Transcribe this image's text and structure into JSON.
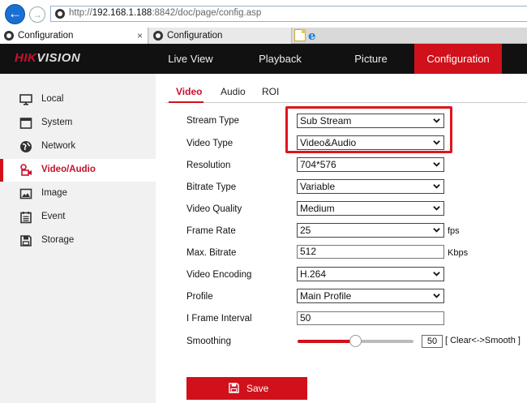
{
  "browser": {
    "url_prefix": "http://",
    "url_host": "192.168.1.188",
    "url_rest": ":8842/doc/page/config.asp",
    "tabs": [
      {
        "label": "Configuration",
        "active": true
      },
      {
        "label": "Configuration",
        "active": false
      }
    ],
    "close_glyph": "×"
  },
  "header": {
    "logo_red": "HIK",
    "logo_rest": "VISION",
    "nav": [
      "Live View",
      "Playback",
      "Picture",
      "Configuration"
    ],
    "active_nav": "Configuration"
  },
  "sidebar": {
    "items": [
      {
        "label": "Local",
        "icon": "monitor-icon"
      },
      {
        "label": "System",
        "icon": "window-icon"
      },
      {
        "label": "Network",
        "icon": "globe-icon"
      },
      {
        "label": "Video/Audio",
        "icon": "video-audio-icon",
        "active": true
      },
      {
        "label": "Image",
        "icon": "image-icon"
      },
      {
        "label": "Event",
        "icon": "calendar-icon"
      },
      {
        "label": "Storage",
        "icon": "floppy-icon"
      }
    ]
  },
  "subtabs": {
    "items": [
      "Video",
      "Audio",
      "ROI"
    ],
    "active": "Video"
  },
  "form": {
    "stream_type": {
      "label": "Stream Type",
      "value": "Sub Stream"
    },
    "video_type": {
      "label": "Video Type",
      "value": "Video&Audio"
    },
    "resolution": {
      "label": "Resolution",
      "value": "704*576"
    },
    "bitrate_type": {
      "label": "Bitrate Type",
      "value": "Variable"
    },
    "video_quality": {
      "label": "Video Quality",
      "value": "Medium"
    },
    "frame_rate": {
      "label": "Frame Rate",
      "value": "25",
      "unit": "fps"
    },
    "max_bitrate": {
      "label": "Max. Bitrate",
      "value": "512",
      "unit": "Kbps"
    },
    "video_encoding": {
      "label": "Video Encoding",
      "value": "H.264"
    },
    "profile": {
      "label": "Profile",
      "value": "Main Profile"
    },
    "i_frame_interval": {
      "label": "I Frame Interval",
      "value": "50"
    },
    "smoothing": {
      "label": "Smoothing",
      "value": "50",
      "range_label": "[ Clear<->Smooth ]",
      "level": 0.5
    }
  },
  "save": {
    "label": "Save"
  },
  "colors": {
    "accent": "#d0111b",
    "header_bg": "#111111",
    "sidebar_bg": "#f1f1f1"
  }
}
